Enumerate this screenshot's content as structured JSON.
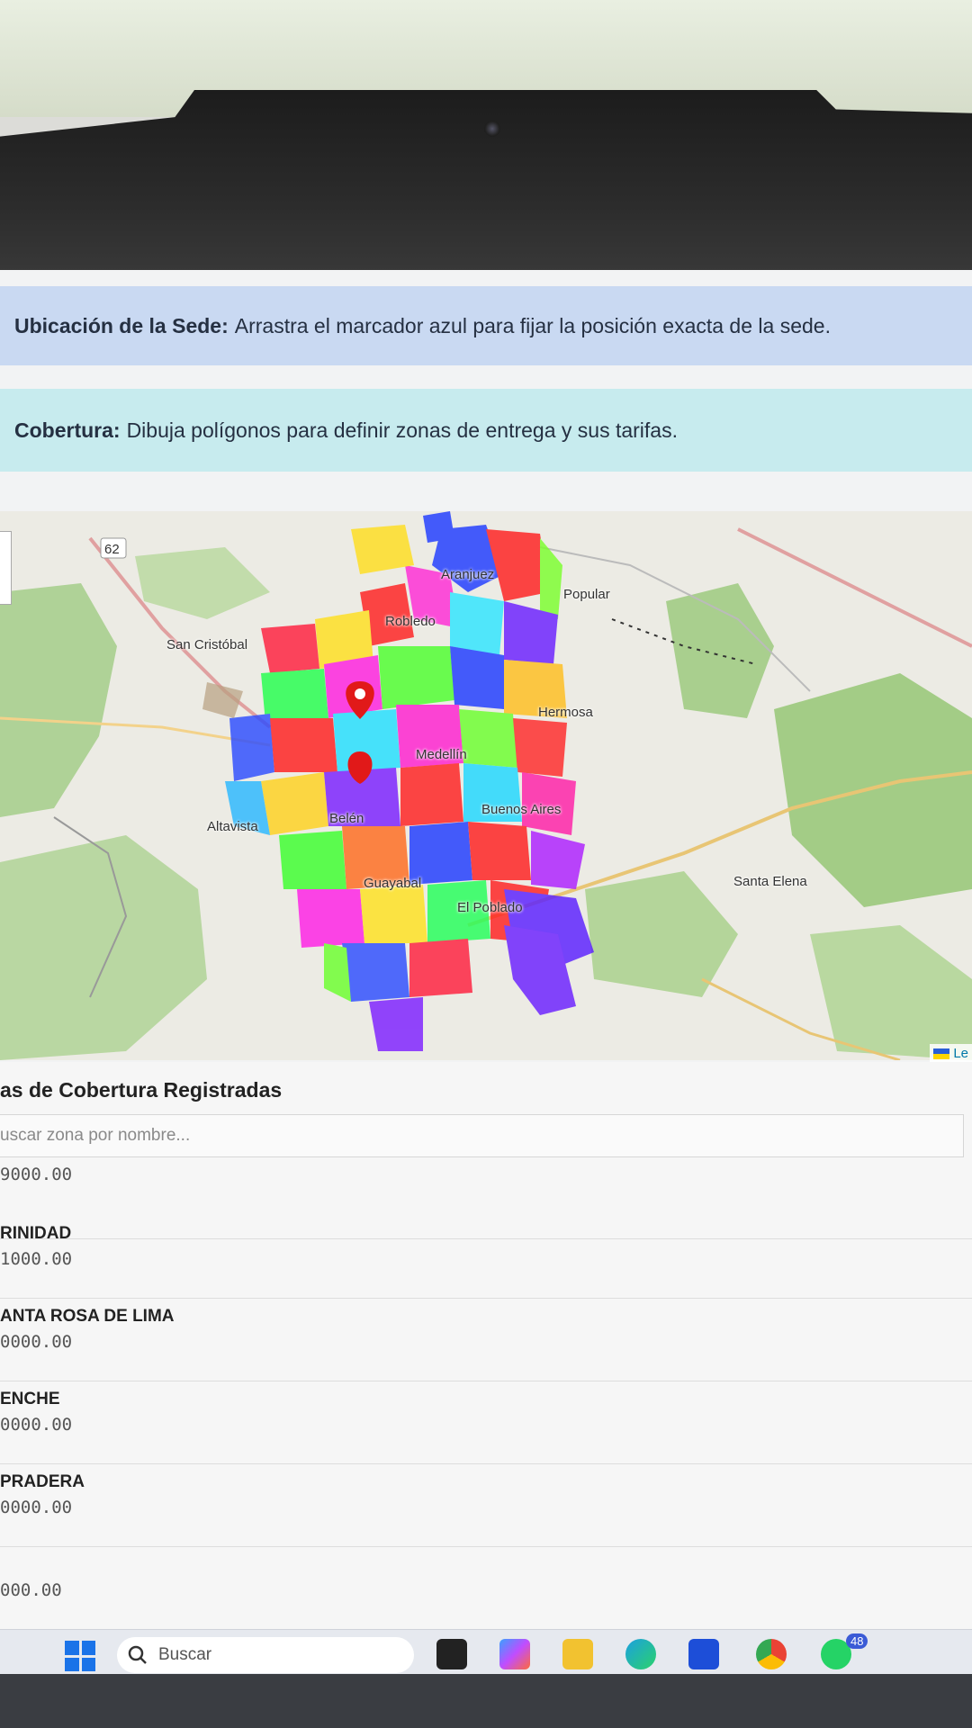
{
  "alerts": {
    "location_label": "Ubicación de la Sede:",
    "location_text": "Arrastra el marcador azul para fijar la posición exacta de la sede.",
    "coverage_label": "Cobertura:",
    "coverage_text": "Dibuja polígonos para definir zonas de entrega y sus tarifas."
  },
  "map": {
    "places": [
      "San Cristóbal",
      "Altavista",
      "Popular",
      "Hermosa",
      "Buenos Aires",
      "Santa Elena",
      "El Poblado",
      "Medellín",
      "Guayabal",
      "Belén",
      "Robledo",
      "Aranjuez"
    ],
    "road_shield": "62",
    "attribution": "Le"
  },
  "zones_panel": {
    "title": "as de Cobertura Registradas",
    "search_placeholder": "uscar zona por nombre..."
  },
  "zones": [
    {
      "name": "",
      "price": "9000.00"
    },
    {
      "name": "RINIDAD",
      "price": "1000.00"
    },
    {
      "name": "ANTA ROSA DE LIMA",
      "price": "0000.00"
    },
    {
      "name": "ENCHE",
      "price": "0000.00"
    },
    {
      "name": "PRADERA",
      "price": "0000.00"
    },
    {
      "name": "",
      "price": "000.00"
    }
  ],
  "taskbar": {
    "search_label": "Buscar",
    "notification_count": "48"
  }
}
